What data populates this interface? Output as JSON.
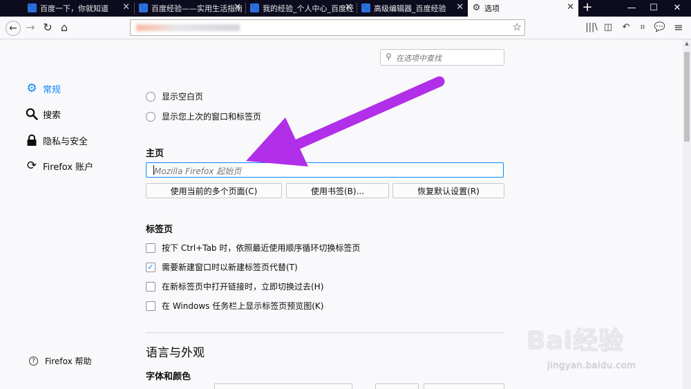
{
  "tabs": [
    {
      "label": "百度一下，你就知道",
      "favicon": "baidu-paw"
    },
    {
      "label": "百度经验——实用生活指南",
      "favicon": "baidu-paw"
    },
    {
      "label": "我的经验_个人中心_百度经",
      "favicon": "baidu-paw"
    },
    {
      "label": "高级编辑器_百度经验",
      "favicon": "baidu-paw"
    },
    {
      "label": "选项",
      "favicon": "gear-icon",
      "active": true
    }
  ],
  "window": {
    "new_tab": "+",
    "minimize": "—",
    "maximize": "☐",
    "close": "✕"
  },
  "search": {
    "placeholder": "在选项中查找"
  },
  "sidebar": {
    "items": [
      {
        "label": "常规",
        "icon": "gear-icon",
        "selected": true
      },
      {
        "label": "搜索",
        "icon": "search-icon"
      },
      {
        "label": "隐私与安全",
        "icon": "lock-icon"
      },
      {
        "label": "Firefox 账户",
        "icon": "sync-icon"
      }
    ],
    "help": "Firefox 帮助"
  },
  "startup": {
    "options": [
      "显示空白页",
      "显示您上次的窗口和标签页"
    ]
  },
  "homepage": {
    "heading": "主页",
    "placeholder": "Mozilla Firefox 起始页",
    "buttons": [
      "使用当前的多个页面(C)",
      "使用书签(B)...",
      "恢复默认设置(R)"
    ]
  },
  "tabs_section": {
    "heading": "标签页",
    "options": [
      {
        "label": "按下 Ctrl+Tab 时，依照最近使用顺序循环切换标签页",
        "checked": false
      },
      {
        "label": "需要新建窗口时以新建标签页代替(T)",
        "checked": true
      },
      {
        "label": "在新标签页中打开链接时，立即切换过去(H)",
        "checked": false
      },
      {
        "label": "在 Windows 任务栏上显示标签页预览图(K)",
        "checked": false
      }
    ]
  },
  "language": {
    "heading": "语言与外观",
    "subheading": "字体和颜色"
  },
  "watermark": {
    "brand": "Bai经验",
    "url": "jingyan.baidu.com"
  },
  "colors": {
    "accent": "#0a84ff",
    "arrow": "#b12fe8",
    "tabbar": "#0c0c1e"
  }
}
